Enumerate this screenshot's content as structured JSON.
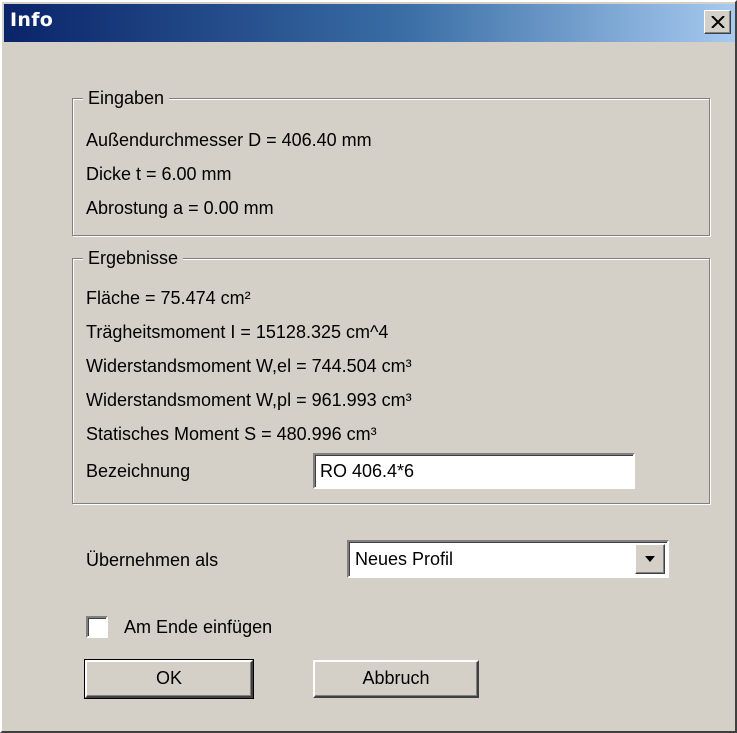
{
  "window": {
    "title": "Info",
    "close_symbol": "×"
  },
  "eingaben": {
    "legend": "Eingaben",
    "lines": [
      "Außendurchmesser D = 406.40 mm",
      "Dicke t = 6.00 mm",
      "Abrostung a = 0.00 mm"
    ]
  },
  "ergebnisse": {
    "legend": "Ergebnisse",
    "lines": [
      "Fläche = 75.474 cm²",
      "Trägheitsmoment I = 15128.325 cm^4",
      "Widerstandsmoment W,el = 744.504 cm³",
      "Widerstandsmoment W,pl = 961.993 cm³",
      "Statisches Moment S = 480.996 cm³"
    ],
    "bezeichnung_label": "Bezeichnung",
    "bezeichnung_value": "RO 406.4*6"
  },
  "uebernehmen": {
    "label": "Übernehmen als",
    "selected": "Neues Profil"
  },
  "checkbox": {
    "label": "Am Ende einfügen",
    "checked": false
  },
  "buttons": {
    "ok": "OK",
    "cancel": "Abbruch"
  },
  "colors": {
    "titlebar_start": "#0a246a",
    "titlebar_end": "#a6caf0",
    "face": "#d4d0c8"
  }
}
